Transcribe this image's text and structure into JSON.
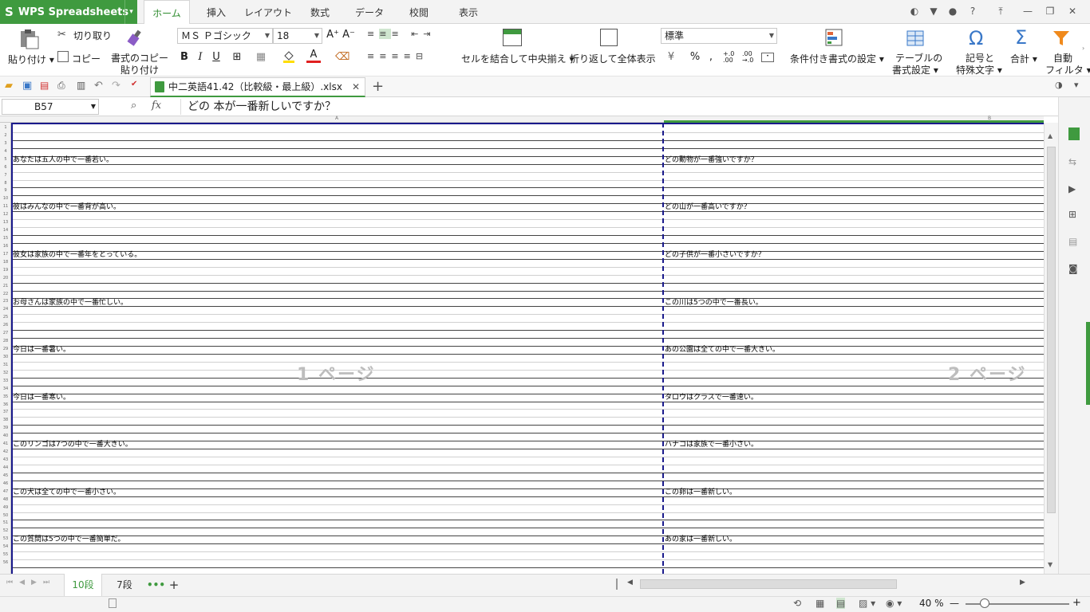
{
  "app": {
    "name": "WPS Spreadsheets",
    "menu_caret": "▾"
  },
  "ribbon_tabs": [
    "ホーム",
    "挿入",
    "レイアウト",
    "数式",
    "データ",
    "校閲",
    "表示"
  ],
  "window_controls": {
    "minimize": "—",
    "restore": "❐",
    "close": "✕",
    "help": "?"
  },
  "ribbon": {
    "paste": "貼り付け",
    "cut": "切り取り",
    "copy": "コピー",
    "format_painter_line1": "書式のコピー",
    "format_painter_line2": "貼り付け",
    "font_name": "ＭＳ Ｐゴシック",
    "font_size": "18",
    "bold": "B",
    "italic": "I",
    "underline": "U",
    "font_grow": "A⁺",
    "font_shrink": "A⁻",
    "font_color": "A",
    "merge_center": "セルを結合して中央揃え",
    "wrap_text": "折り返して全体表示",
    "number_format": "標準",
    "percent": "%",
    "comma": ",",
    "inc_decimal": "+.0 .00",
    "dec_decimal": ".00 →.0",
    "conditional_format": "条件付き書式の設定",
    "table_format_line1": "テーブルの",
    "table_format_line2": "書式設定",
    "symbol_line1": "記号と",
    "symbol_line2": "特殊文字",
    "sum": "合計",
    "autofilter_line1": "自動",
    "autofilter_line2": "フィルタ"
  },
  "document": {
    "tab_title": "中二英語41.42（比較級・最上級）.xlsx",
    "close": "✕",
    "new_tab": "+"
  },
  "formula_bar": {
    "name_box": "B57",
    "fx": "fx",
    "formula": "どの 本が一番新しいですか？"
  },
  "columns": {
    "a": "A",
    "b": "B"
  },
  "rows": [
    {
      "n": "1"
    },
    {
      "n": "2"
    },
    {
      "n": "3",
      "a": "あなたは五人の中で一番若い。",
      "b": "どの動物が一番強いですか？"
    },
    {
      "n": "4"
    },
    {
      "n": "5"
    },
    {
      "n": "6"
    },
    {
      "n": "7"
    },
    {
      "n": "8"
    },
    {
      "n": "9",
      "a": "彼はみんなの中で一番背が高い。",
      "b": "どの山が一番高いですか？"
    },
    {
      "n": "10"
    },
    {
      "n": "11"
    },
    {
      "n": "12"
    },
    {
      "n": "13"
    },
    {
      "n": "14"
    },
    {
      "n": "15",
      "a": "彼女は家族の中で一番年をとっている。",
      "b": "どの子供が一番小さいですか？"
    },
    {
      "n": "16"
    },
    {
      "n": "17"
    },
    {
      "n": "18"
    },
    {
      "n": "19"
    },
    {
      "n": "20"
    },
    {
      "n": "21",
      "a": "お母さんは家族の中で一番忙しい。",
      "b": "この川は5つの中で一番長い。"
    },
    {
      "n": "22"
    },
    {
      "n": "23"
    },
    {
      "n": "24"
    },
    {
      "n": "25"
    },
    {
      "n": "26"
    },
    {
      "n": "27",
      "a": "今日は一番暑い。",
      "b": "あの公園は全ての中で一番大きい。"
    },
    {
      "n": "28"
    },
    {
      "n": "29"
    },
    {
      "n": "30"
    },
    {
      "n": "31"
    },
    {
      "n": "32"
    },
    {
      "n": "33",
      "a": "今日は一番寒い。",
      "b": "タロウはクラスで一番速い。"
    },
    {
      "n": "34"
    },
    {
      "n": "35"
    },
    {
      "n": "36"
    },
    {
      "n": "37"
    },
    {
      "n": "38"
    },
    {
      "n": "39",
      "a": "このリンゴは7つの中で一番大きい。",
      "b": "ハナコは家族で一番小さい。"
    },
    {
      "n": "40"
    },
    {
      "n": "41"
    },
    {
      "n": "42"
    },
    {
      "n": "43"
    },
    {
      "n": "44"
    },
    {
      "n": "45",
      "a": "この犬は全ての中で一番小さい。",
      "b": "この卵は一番新しい。"
    },
    {
      "n": "46"
    },
    {
      "n": "47"
    },
    {
      "n": "48"
    },
    {
      "n": "49"
    },
    {
      "n": "50"
    },
    {
      "n": "51",
      "a": "この質問は5つの中で一番簡単だ。",
      "b": "あの家は一番新しい。"
    },
    {
      "n": "52"
    },
    {
      "n": "53"
    },
    {
      "n": "54"
    },
    {
      "n": "55"
    },
    {
      "n": "56"
    }
  ],
  "page_labels": [
    "1 ページ",
    "2 ページ"
  ],
  "sheet_tabs": [
    "10段",
    "7段"
  ],
  "sheet_tab_more": "•••",
  "sheet_tab_add": "+",
  "status": {
    "zoom": "40 %",
    "zoom_minus": "—",
    "zoom_plus": "+"
  },
  "colors": {
    "accent": "#3f9a3f",
    "page_break": "#1a1a8c"
  }
}
